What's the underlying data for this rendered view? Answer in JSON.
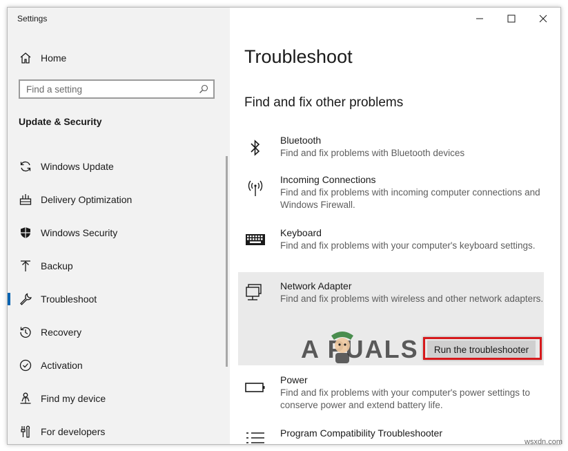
{
  "window": {
    "title": "Settings"
  },
  "sidebar": {
    "home_label": "Home",
    "search_placeholder": "Find a setting",
    "section_title": "Update & Security",
    "items": [
      {
        "label": "Windows Update",
        "icon": "refresh-icon",
        "selected": false
      },
      {
        "label": "Delivery Optimization",
        "icon": "delivery-optimization-icon",
        "selected": false
      },
      {
        "label": "Windows Security",
        "icon": "shield-icon",
        "selected": false
      },
      {
        "label": "Backup",
        "icon": "backup-arrow-icon",
        "selected": false
      },
      {
        "label": "Troubleshoot",
        "icon": "wrench-icon",
        "selected": true
      },
      {
        "label": "Recovery",
        "icon": "recovery-icon",
        "selected": false
      },
      {
        "label": "Activation",
        "icon": "check-circle-icon",
        "selected": false
      },
      {
        "label": "Find my device",
        "icon": "person-pin-icon",
        "selected": false
      },
      {
        "label": "For developers",
        "icon": "developer-tools-icon",
        "selected": false
      }
    ]
  },
  "main": {
    "title": "Troubleshoot",
    "section_title": "Find and fix other problems",
    "items": [
      {
        "name": "Bluetooth",
        "desc": "Find and fix problems with Bluetooth devices",
        "icon": "bluetooth-icon"
      },
      {
        "name": "Incoming Connections",
        "desc": "Find and fix problems with incoming computer connections and Windows Firewall.",
        "icon": "antenna-icon"
      },
      {
        "name": "Keyboard",
        "desc": "Find and fix problems with your computer's keyboard settings.",
        "icon": "keyboard-icon"
      },
      {
        "name": "Network Adapter",
        "desc": "Find and fix problems with wireless and other network adapters.",
        "icon": "network-adapter-icon",
        "expanded": true,
        "button": "Run the troubleshooter"
      },
      {
        "name": "Power",
        "desc": "Find and fix problems with your computer's power settings to conserve power and extend battery life.",
        "icon": "battery-icon"
      },
      {
        "name": "Program Compatibility Troubleshooter",
        "desc": "",
        "icon": "list-icon"
      }
    ]
  },
  "watermark": {
    "brand": "A PUALS",
    "site": "wsxdn.com"
  },
  "colors": {
    "accent": "#0063b1",
    "highlight": "#d7191c",
    "sidebar_bg": "#f2f2f2",
    "expanded_bg": "#eaeaea"
  }
}
